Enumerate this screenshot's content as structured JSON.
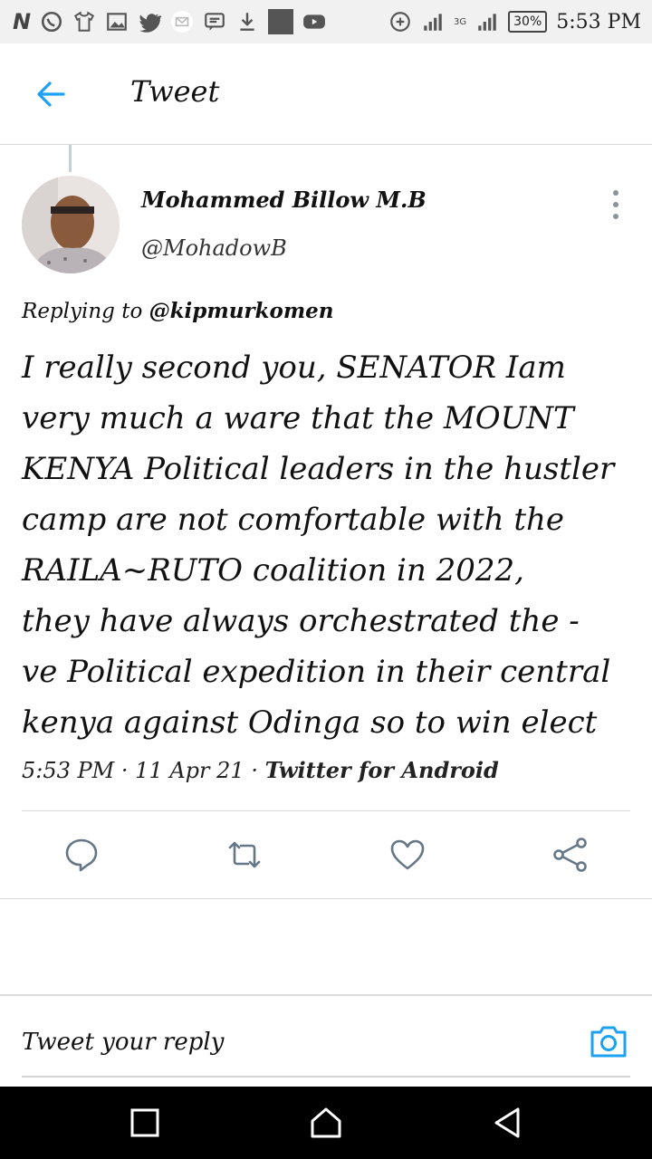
{
  "status_bar": {
    "app_letter": "N",
    "battery": "30%",
    "network": "3G",
    "time": "5:53 PM",
    "icons": [
      "n-icon",
      "whatsapp-icon",
      "tshirt-icon",
      "gallery-icon",
      "twitter-icon",
      "email-icon",
      "message-icon",
      "download-icon",
      "app-icon",
      "youtube-icon",
      "data-saver-icon",
      "signal-icon",
      "battery-icon"
    ]
  },
  "header": {
    "title": "Tweet",
    "back_icon": "arrow-left-icon"
  },
  "tweet": {
    "author_name": "Mohammed Billow M.B",
    "author_handle": "@MohadowB",
    "replying_prefix": "Replying to",
    "replying_to": "@kipmurkomen",
    "text": "I really second you, SENATOR Iam\nvery much a ware that the MOUNT\nKENYA Political leaders in the hustler\ncamp are not comfortable with the\nRAILA~RUTO coalition in 2022,\nthey have always orchestrated the -\nve Political expedition in their central\nkenya against Odinga so to win elect",
    "time": "5:53 PM",
    "date": "11 Apr 21",
    "separator": "·",
    "client": "Twitter for Android"
  },
  "actions": [
    "reply-icon",
    "retweet-icon",
    "like-icon",
    "share-icon"
  ],
  "reply": {
    "placeholder": "Tweet your reply"
  },
  "colors": {
    "accent": "#1da1f2",
    "icon_gray": "#657786",
    "nav_bg": "#000000",
    "status_bg": "#f1f1f1"
  }
}
